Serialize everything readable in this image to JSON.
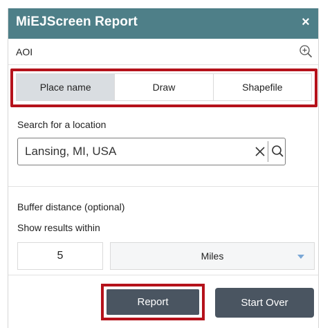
{
  "window": {
    "title": "MiEJScreen Report",
    "close_symbol": "×"
  },
  "aoi": {
    "label": "AOI",
    "zoom_icon": "zoom-in-icon"
  },
  "tabs": [
    {
      "label": "Place name",
      "active": true
    },
    {
      "label": "Draw",
      "active": false
    },
    {
      "label": "Shapefile",
      "active": false
    }
  ],
  "search": {
    "label": "Search for a location",
    "value": "Lansing, MI, USA",
    "clear_icon": "close-icon",
    "search_icon": "search-icon"
  },
  "buffer": {
    "label": "Buffer distance (optional)",
    "within_label": "Show results within",
    "distance": "5",
    "unit": "Miles"
  },
  "actions": {
    "report_label": "Report",
    "start_over_label": "Start Over"
  },
  "colors": {
    "titlebar": "#4e7f88",
    "highlight": "#b5121b",
    "button": "#4a5561",
    "active_tab": "#d9dde1"
  }
}
